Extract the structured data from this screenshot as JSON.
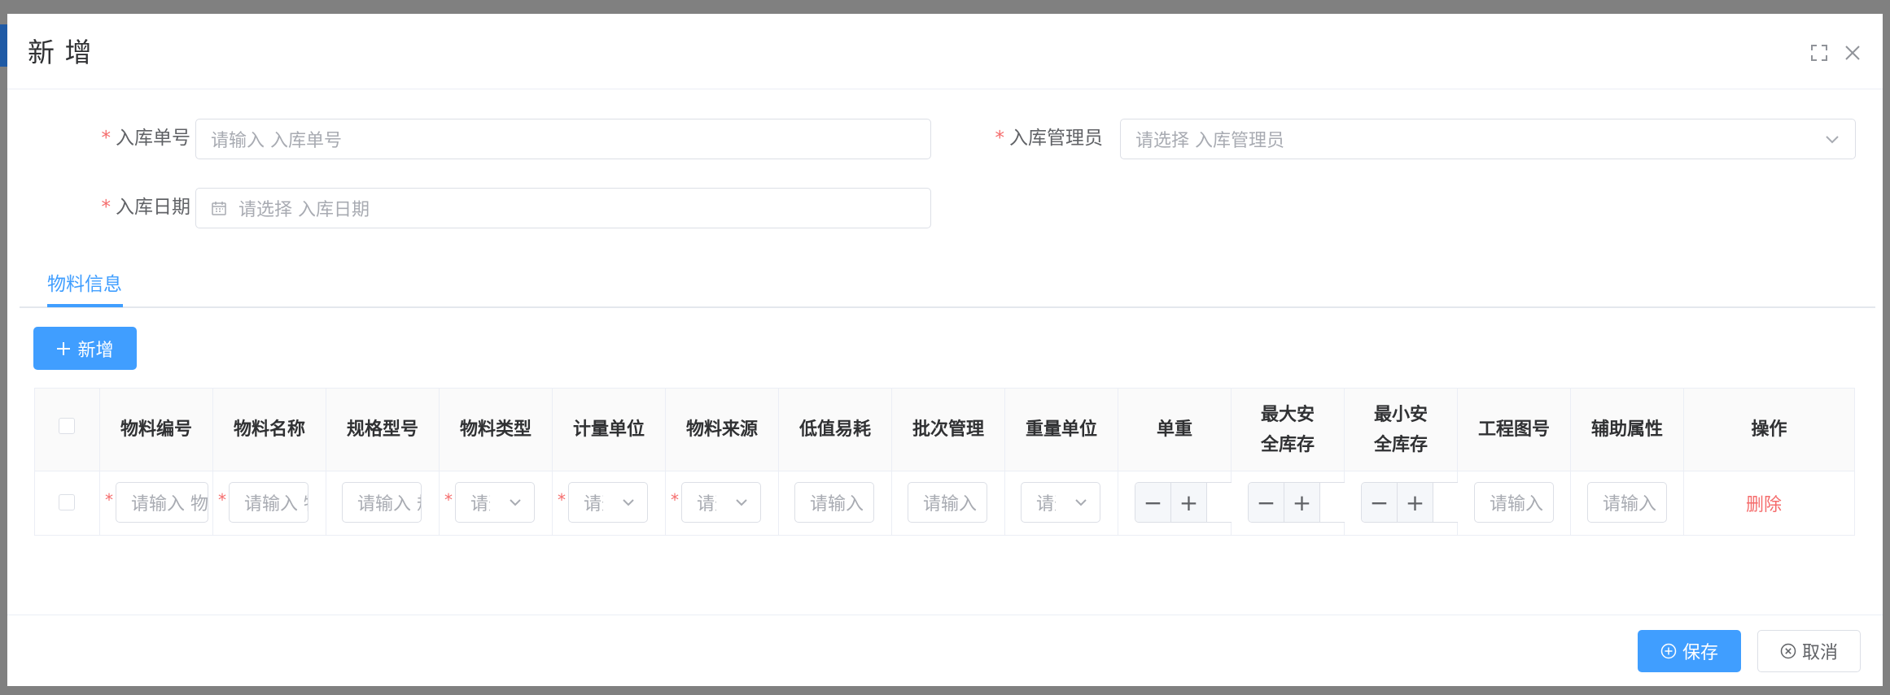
{
  "dialog": {
    "title": "新 增"
  },
  "form": {
    "receipt_no": {
      "label": "入库单号",
      "placeholder": "请输入 入库单号"
    },
    "manager": {
      "label": "入库管理员",
      "placeholder": "请选择 入库管理员"
    },
    "receipt_date": {
      "label": "入库日期",
      "placeholder": "请选择 入库日期"
    },
    "required_mark": "*"
  },
  "tabs": [
    {
      "label": "物料信息",
      "active": true
    }
  ],
  "toolbar": {
    "add_label": "新增"
  },
  "table": {
    "headers": [
      "物料编号",
      "物料名称",
      "规格型号",
      "物料类型",
      "计量单位",
      "物料来源",
      "低值易耗",
      "批次管理",
      "重量单位",
      "单重",
      "最大安全库存",
      "最小安全库存",
      "工程图号",
      "辅助属性",
      "操作"
    ],
    "row": {
      "material_code_placeholder": "请输入 物料编号",
      "material_name_placeholder": "请输入 物料名称",
      "spec_placeholder": "请输入 规格型号",
      "type_placeholder": "请选择",
      "unit_placeholder": "请选择",
      "source_placeholder": "请选择",
      "low_value_placeholder": "请输入",
      "batch_placeholder": "请输入",
      "weight_unit_placeholder": "请选择",
      "drawing_placeholder": "请输入",
      "aux_placeholder": "请输入",
      "delete_label": "删除"
    }
  },
  "footer": {
    "save_label": "保存",
    "cancel_label": "取消"
  },
  "colors": {
    "primary": "#409eff",
    "danger": "#f56c6c"
  }
}
